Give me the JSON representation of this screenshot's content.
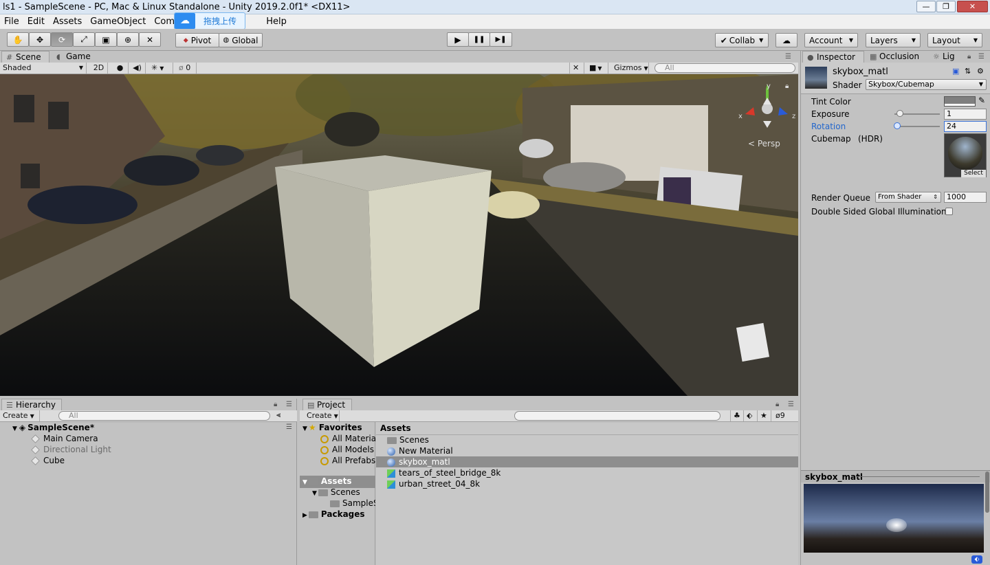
{
  "window": {
    "title": "ls1 - SampleScene - PC, Mac & Linux Standalone - Unity 2019.2.0f1* <DX11>",
    "min": "—",
    "max": "❐",
    "close": "✕"
  },
  "menu": [
    "File",
    "Edit",
    "Assets",
    "GameObject",
    "Compo",
    "Help"
  ],
  "upload_badge": {
    "label": "拖拽上传"
  },
  "toolbar": {
    "pivot": "Pivot",
    "global": "Global",
    "collab": "Collab",
    "account": "Account",
    "layers": "Layers",
    "layout": "Layout",
    "play": "▶",
    "pause": "❚❚",
    "step": "▶❚"
  },
  "scene_tabs": {
    "scene": "Scene",
    "game": "Game"
  },
  "scene_bar": {
    "shading": "Shaded",
    "mode2d": "2D",
    "fx_count": "0",
    "gizmos": "Gizmos",
    "search_placeholder": "All"
  },
  "viewport": {
    "persp_label": "< Persp",
    "axis_x": "x",
    "axis_y": "y",
    "axis_z": "z"
  },
  "hierarchy": {
    "tab": "Hierarchy",
    "create": "Create",
    "search_placeholder": "All",
    "scene": "SampleScene*",
    "items": [
      "Main Camera",
      "Directional Light",
      "Cube"
    ]
  },
  "project": {
    "tab": "Project",
    "create": "Create",
    "hidden_count": "9",
    "favorites_header": "Favorites",
    "favorites": [
      "All Materia",
      "All Models",
      "All Prefabs"
    ],
    "assets_header": "Assets",
    "tree_scenes": "Scenes",
    "tree_sample": "SampleS",
    "packages": "Packages",
    "breadcrumb": "Assets",
    "files": [
      "Scenes",
      "New Material",
      "skybox_matl",
      "tears_of_steel_bridge_8k",
      "urban_street_04_8k"
    ],
    "selected_file": "skybox_matl"
  },
  "inspector": {
    "tabs": [
      "Inspector",
      "Occlusion",
      "Lig"
    ],
    "material_name": "skybox_matl",
    "shader_label": "Shader",
    "shader_value": "Skybox/Cubemap",
    "tint_label": "Tint Color",
    "exposure_label": "Exposure",
    "exposure_value": "1",
    "exposure_slider": 0.125,
    "rotation_label": "Rotation",
    "rotation_value": "24",
    "rotation_slider": 0.067,
    "cubemap_label": "Cubemap",
    "cubemap_hdr": "(HDR)",
    "select_label": "Select",
    "render_queue_label": "Render Queue",
    "render_queue_mode": "From Shader",
    "render_queue_value": "1000",
    "double_sided_label": "Double Sided Global Illumination",
    "preview_title": "skybox_matl"
  },
  "colors": {
    "accent": "#3a72d8",
    "selection": "#8e8e8e",
    "rotation_label": "#2266cc"
  }
}
